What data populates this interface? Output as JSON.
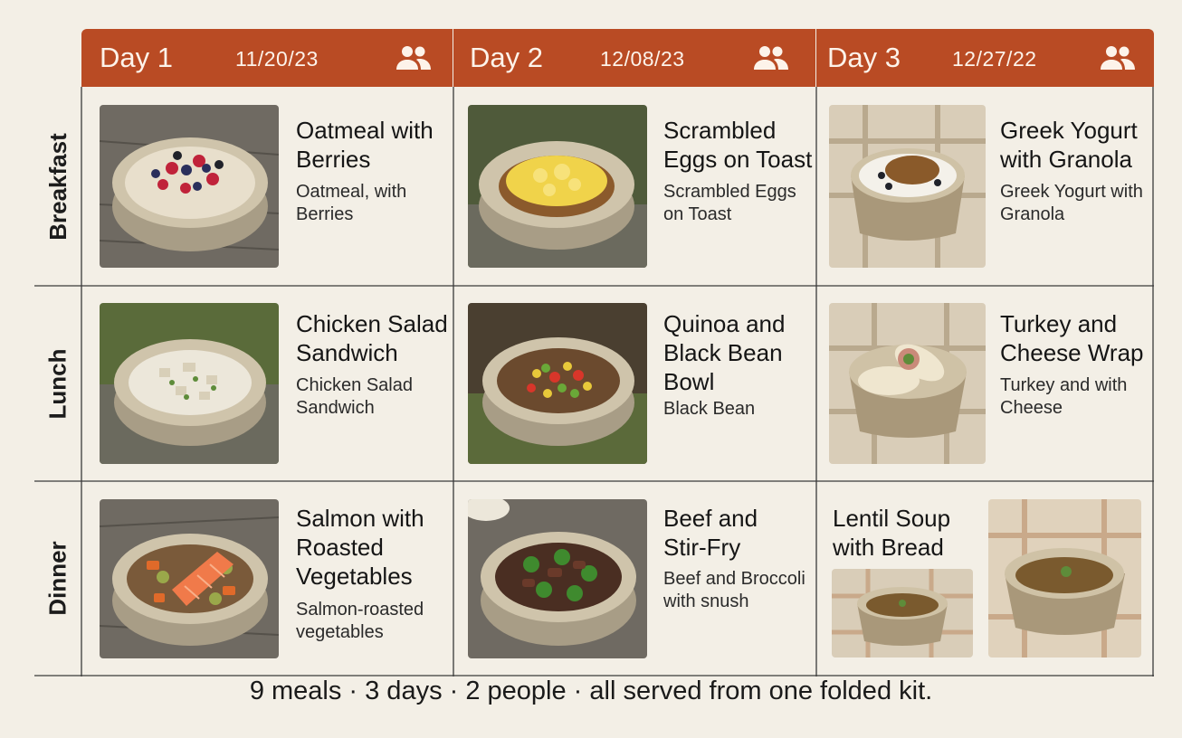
{
  "days": [
    {
      "label": "Day 1",
      "date": "11/20/23"
    },
    {
      "label": "Day 2",
      "date": "12/08/23"
    },
    {
      "label": "Day 3",
      "date": "12/27/22"
    }
  ],
  "meals": [
    "Breakfast",
    "Lunch",
    "Dinner"
  ],
  "cells": {
    "b1": {
      "title": "Oatmeal with Berries",
      "desc": "Oatmeal, with Berries"
    },
    "b2": {
      "title": "Scrambled Eggs on Toast",
      "desc": "Scrambled Eggs on Toast"
    },
    "b3": {
      "title": "Greek Yogurt with Granola",
      "desc": "Greek Yogurt with Granola"
    },
    "l1": {
      "title": "Chicken Salad Sandwich",
      "desc": "Chicken Salad Sandwich"
    },
    "l2": {
      "title": "Quinoa and Black Bean Bowl",
      "desc": "Black Bean"
    },
    "l3": {
      "title": "Turkey and Cheese Wrap",
      "desc": "Turkey and with Cheese"
    },
    "d1": {
      "title": "Salmon with Roasted Vegetables",
      "desc": "Salmon-roasted vegetables"
    },
    "d2": {
      "title": "Beef and Stir-Fry",
      "desc": "Beef and Broccoli with snush"
    },
    "d3": {
      "title": "Lentil Soup with Bread",
      "desc": ""
    }
  },
  "footer": "9 meals · 3 days · 2 people · all served from one folded kit.",
  "colors": {
    "header": "#b94b24",
    "background": "#f3efe6",
    "grid": "#2b2b2b"
  },
  "icons": [
    "people-icon"
  ]
}
